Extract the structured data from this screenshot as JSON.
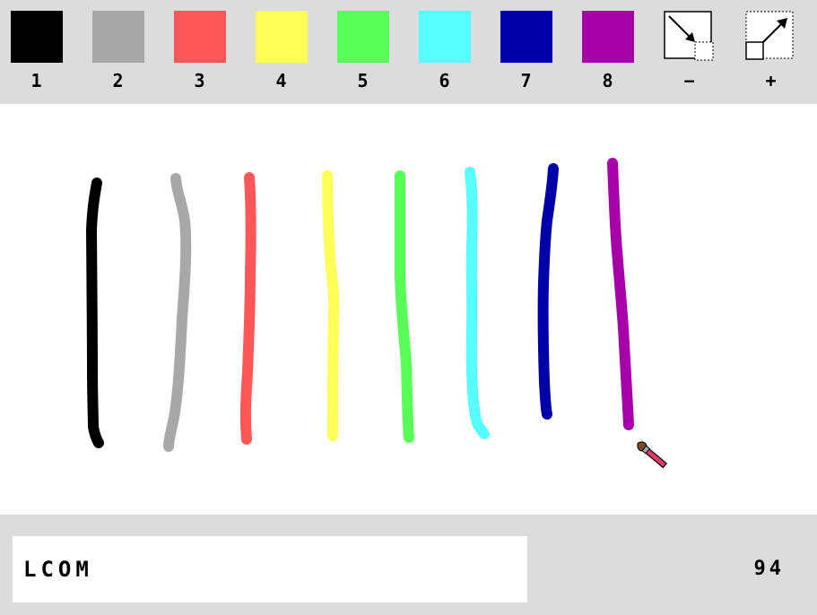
{
  "toolbar": {
    "colors": [
      {
        "key": "1",
        "color": "#000000"
      },
      {
        "key": "2",
        "color": "#a8a8a8"
      },
      {
        "key": "3",
        "color": "#ff5757"
      },
      {
        "key": "4",
        "color": "#ffff57"
      },
      {
        "key": "5",
        "color": "#57ff57"
      },
      {
        "key": "6",
        "color": "#57ffff"
      },
      {
        "key": "7",
        "color": "#0000a8"
      },
      {
        "key": "8",
        "color": "#a800a8"
      }
    ],
    "size_decrease": {
      "key": "−",
      "icon": "shrink-brush-icon"
    },
    "size_increase": {
      "key": "+",
      "icon": "grow-brush-icon"
    }
  },
  "canvas": {
    "cursor_icon": "paintbrush-cursor-icon"
  },
  "status": {
    "text_value": "LCOM",
    "counter": "94"
  }
}
